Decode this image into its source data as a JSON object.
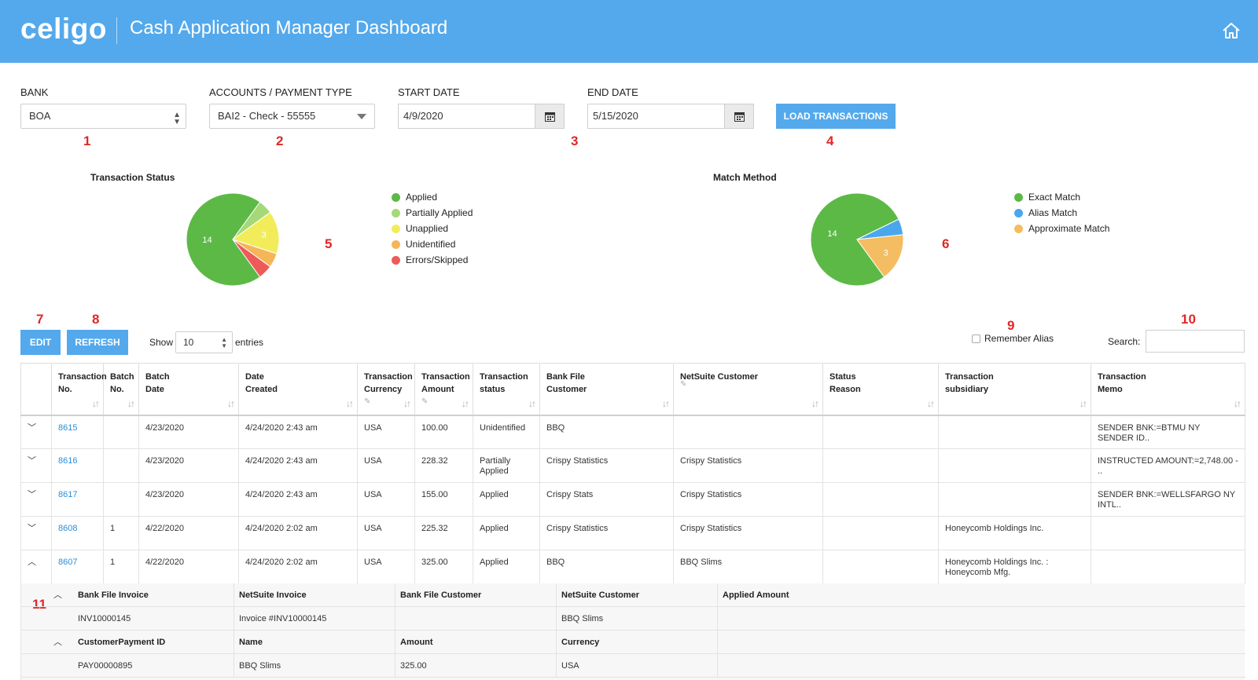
{
  "header": {
    "logo": "celigo",
    "title": "Cash Application Manager Dashboard",
    "home_icon": "home-icon"
  },
  "filters": {
    "bank_label": "BANK",
    "bank_value": "BOA",
    "account_label": "ACCOUNTS / PAYMENT TYPE",
    "account_value": "BAI2 - Check - 55555",
    "start_label": "START DATE",
    "start_value": "4/9/2020",
    "end_label": "END DATE",
    "end_value": "5/15/2020",
    "load_button": "LOAD TRANSACTIONS"
  },
  "annotations": [
    "1",
    "2",
    "3",
    "4",
    "5",
    "6",
    "7",
    "8",
    "9",
    "10",
    "11"
  ],
  "chart_data": [
    {
      "type": "pie",
      "title": "Transaction Status",
      "labels": [
        "Applied",
        "Partially Applied",
        "Unapplied",
        "Unidentified",
        "Errors/Skipped"
      ],
      "values": [
        14,
        1,
        3,
        1,
        1
      ],
      "colors": [
        "#5cb946",
        "#a5d977",
        "#f2ec5b",
        "#f4b659",
        "#ed5a5a"
      ],
      "data_labels": [
        "14",
        "",
        "3",
        "",
        ""
      ],
      "legend": "right"
    },
    {
      "type": "pie",
      "title": "Match Method",
      "labels": [
        "Exact Match",
        "Alias Match",
        "Approximate Match"
      ],
      "values": [
        14,
        1,
        3
      ],
      "colors": [
        "#5cb946",
        "#4aa7ee",
        "#f4bd62"
      ],
      "data_labels": [
        "14",
        "",
        "3"
      ],
      "legend": "right"
    }
  ],
  "toolbar": {
    "edit": "EDIT",
    "refresh": "REFRESH",
    "show": "Show",
    "entries_value": "10",
    "entries": "entries",
    "remember_alias": "Remember Alias",
    "search_label": "Search:"
  },
  "table": {
    "columns": [
      "",
      "Transaction No.",
      "Batch No.",
      "Batch Date",
      "Date Created",
      "Transaction Currency",
      "Transaction Amount",
      "Transaction status",
      "Bank File Customer",
      "NetSuite Customer",
      "Status Reason",
      "Transaction subsidiary",
      "Transaction Memo"
    ],
    "rows": [
      [
        "8615",
        "",
        "4/23/2020",
        "4/24/2020 2:43 am",
        "USA",
        "100.00",
        "Unidentified",
        "BBQ",
        "",
        "",
        "",
        "SENDER BNK:=BTMU NY SENDER ID.."
      ],
      [
        "8616",
        "",
        "4/23/2020",
        "4/24/2020 2:43 am",
        "USA",
        "228.32",
        "Partially Applied",
        "Crispy Statistics",
        "Crispy Statistics",
        "",
        "",
        "INSTRUCTED AMOUNT:=2,748.00 - .."
      ],
      [
        "8617",
        "",
        "4/23/2020",
        "4/24/2020 2:43 am",
        "USA",
        "155.00",
        "Applied",
        "Crispy Stats",
        "Crispy Statistics",
        "",
        "",
        "SENDER BNK:=WELLSFARGO NY INTL.."
      ],
      [
        "8608",
        "1",
        "4/22/2020",
        "4/24/2020 2:02 am",
        "USA",
        "225.32",
        "Applied",
        "Crispy Statistics",
        "Crispy Statistics",
        "",
        "Honeycomb Holdings Inc.",
        ""
      ],
      [
        "8607",
        "1",
        "4/22/2020",
        "4/24/2020 2:02 am",
        "USA",
        "325.00",
        "Applied",
        "BBQ",
        "BBQ Slims",
        "",
        "Honeycomb Holdings Inc. : Honeycomb Mfg.",
        ""
      ]
    ]
  },
  "detail": {
    "invoice_headers": [
      "Bank File Invoice",
      "NetSuite Invoice",
      "Bank File Customer",
      "NetSuite Customer",
      "Applied Amount"
    ],
    "invoice_row": [
      "INV10000145",
      "Invoice #INV10000145",
      "",
      "BBQ Slims",
      ""
    ],
    "payment_headers": [
      "CustomerPayment ID",
      "Name",
      "Amount",
      "Currency"
    ],
    "payment_row": [
      "PAY00000895",
      "BBQ Slims",
      "325.00",
      "USA"
    ]
  }
}
